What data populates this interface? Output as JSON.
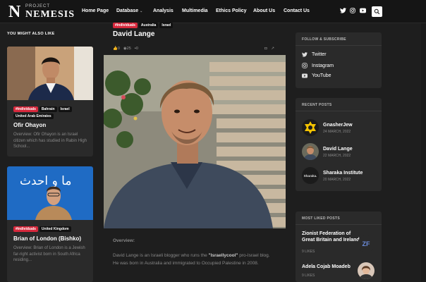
{
  "brand": {
    "small": "PROJECT",
    "big": "NEMESIS"
  },
  "nav": [
    "Home Page",
    "Database",
    "Analysis",
    "Multimedia",
    "Ethics Policy",
    "About Us",
    "Contact Us"
  ],
  "sidebar": {
    "title": "YOU MIGHT ALSO LIKE",
    "cards": [
      {
        "tags": [
          "#individuals",
          "Bahrain",
          "Israel",
          "United Arab Emirates"
        ],
        "title": "Ofir Ohayon",
        "text": "Overview: Ofir Ohayon is an Israel citizen which has studied in Rabin High School..."
      },
      {
        "tags": [
          "#individuals",
          "United Kingdom"
        ],
        "title": "Brian of London (Bishko)",
        "text": "Overview: Brian of London is a Jewish far-right activist born in South Africa residing..."
      }
    ]
  },
  "article": {
    "tags": [
      "#individuals",
      "Australia",
      "Israel"
    ],
    "title": "David Lange",
    "stats": {
      "likes": "0",
      "views": "25",
      "comments": "0"
    },
    "share": {
      "bookmark": "◘",
      "share": "↗"
    },
    "overview_label": "Overview:",
    "overview_pre": "David Lange is an Israeli blogger who runs the ",
    "overview_bold": "\"Israellycool\"",
    "overview_post": " pro-Israel blog. He was born in Australia and immigrated to Occupied Palestine in 2008."
  },
  "follow": {
    "title": "FOLLOW & SUBSCRIBE",
    "items": [
      "Twitter",
      "Instagram",
      "YouTube"
    ]
  },
  "recent": {
    "title": "RECENT POSTS",
    "items": [
      {
        "title": "GnasherJew",
        "date": "24 MARCH, 2022"
      },
      {
        "title": "David Lange",
        "date": "22 MARCH, 2022"
      },
      {
        "title": "Sharaka Institute",
        "date": "20 MARCH, 2022",
        "thumb_text": "Sharaka."
      }
    ]
  },
  "liked": {
    "title": "MOST LIKED POSTS",
    "items": [
      {
        "title": "Zionist Federation of Great Britain and Ireland",
        "likes": "9 LIKES",
        "thumb_text": "ZF"
      },
      {
        "title": "Adela Cojab Moadeb",
        "likes": "9 LIKES"
      }
    ]
  },
  "colors": {
    "accent": "#d6283c",
    "background": "#1e1e1e",
    "panel": "#2a2a2a"
  }
}
